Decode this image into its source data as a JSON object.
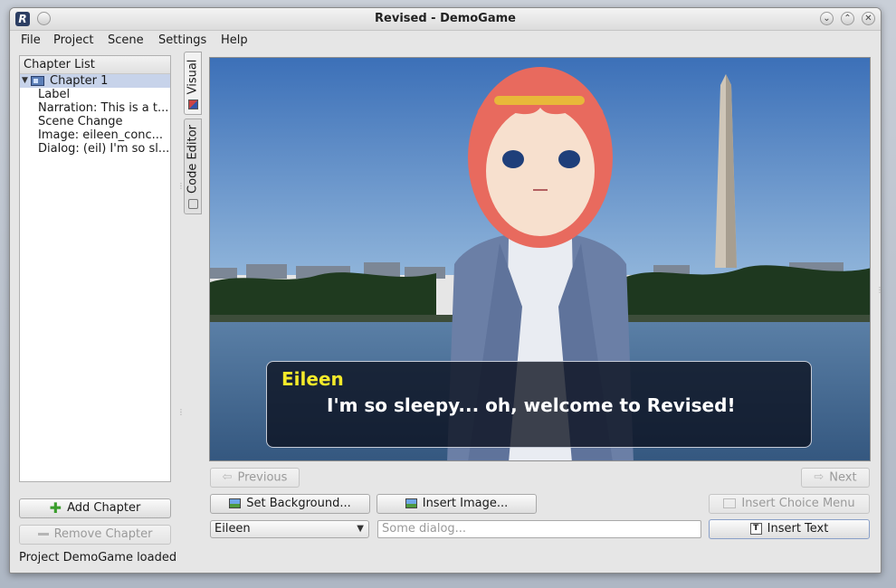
{
  "window": {
    "title": "Revised - DemoGame",
    "logo_letter": "R"
  },
  "menubar": {
    "items": [
      "File",
      "Project",
      "Scene",
      "Settings",
      "Help"
    ]
  },
  "chapter_list": {
    "header": "Chapter List",
    "chapter": "Chapter 1",
    "items": [
      "Label",
      "Narration: This is a t...",
      "Scene Change",
      "Image:  eileen_conc...",
      "Dialog: (eil) I'm so sl..."
    ]
  },
  "left_buttons": {
    "add_chapter": "Add Chapter",
    "remove_chapter": "Remove Chapter"
  },
  "status": "Project DemoGame loaded",
  "tabs": {
    "visual": "Visual",
    "code_editor": "Code Editor"
  },
  "preview": {
    "speaker": "Eileen",
    "line": "I'm so sleepy... oh, welcome to Revised!"
  },
  "nav": {
    "previous": "Previous",
    "next": "Next"
  },
  "actions": {
    "set_background": "Set Background...",
    "insert_image": "Insert Image...",
    "insert_choice_menu": "Insert Choice Menu",
    "insert_text": "Insert Text"
  },
  "dialog_entry": {
    "speaker_selected": "Eileen",
    "placeholder": "Some dialog..."
  },
  "colors": {
    "speaker_name": "#f4ea2a",
    "dialog_text": "#ffffff",
    "selection": "#c7d3ea"
  }
}
